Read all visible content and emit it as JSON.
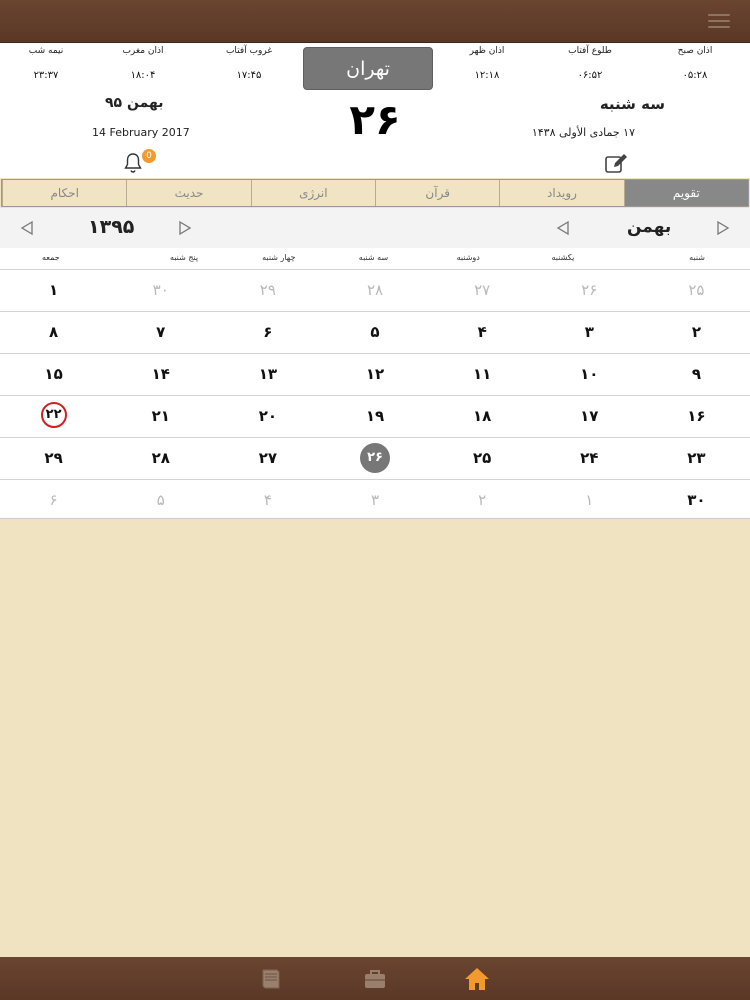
{
  "prayer_times": [
    {
      "label": "اذان صبح",
      "value": "۰۵:۲۸"
    },
    {
      "label": "طلوع آفتاب",
      "value": "۰۶:۵۲"
    },
    {
      "label": "اذان ظهر",
      "value": "۱۲:۱۸"
    },
    {
      "label": "غروب آفتاب",
      "value": "۱۷:۴۵"
    },
    {
      "label": "اذان مغرب",
      "value": "۱۸:۰۴"
    },
    {
      "label": "نیمه شب",
      "value": "۲۳:۳۷"
    }
  ],
  "city": "تهران",
  "today": {
    "day": "۲۶",
    "weekday": "سه شنبه",
    "hijri": "۱۷ جمادی الأولی ۱۴۳۸",
    "persian_month_year": "بهمن ۹۵",
    "gregorian": "14 February 2017"
  },
  "notifications": {
    "count": "0"
  },
  "tabs": [
    "تقویم",
    "رویداد",
    "قرآن",
    "انرژی",
    "حدیث",
    "احکام"
  ],
  "nav": {
    "month": "بهمن",
    "year": "۱۳۹۵"
  },
  "weekdays": [
    "شنبه",
    "یکشنبه",
    "دوشنبه",
    "سه شنبه",
    "چهار شنبه",
    "پنج شنبه",
    "جمعه"
  ],
  "weeks": [
    [
      {
        "d": "۲۵",
        "dim": true
      },
      {
        "d": "۲۶",
        "dim": true
      },
      {
        "d": "۲۷",
        "dim": true
      },
      {
        "d": "۲۸",
        "dim": true
      },
      {
        "d": "۲۹",
        "dim": true
      },
      {
        "d": "۳۰",
        "dim": true
      },
      {
        "d": "۱"
      }
    ],
    [
      {
        "d": "۲"
      },
      {
        "d": "۳"
      },
      {
        "d": "۴"
      },
      {
        "d": "۵"
      },
      {
        "d": "۶"
      },
      {
        "d": "۷"
      },
      {
        "d": "۸"
      }
    ],
    [
      {
        "d": "۹"
      },
      {
        "d": "۱۰"
      },
      {
        "d": "۱۱"
      },
      {
        "d": "۱۲"
      },
      {
        "d": "۱۳"
      },
      {
        "d": "۱۴"
      },
      {
        "d": "۱۵"
      }
    ],
    [
      {
        "d": "۱۶"
      },
      {
        "d": "۱۷"
      },
      {
        "d": "۱۸"
      },
      {
        "d": "۱۹"
      },
      {
        "d": "۲۰"
      },
      {
        "d": "۲۱"
      },
      {
        "d": "۲۲",
        "holiday": true
      }
    ],
    [
      {
        "d": "۲۳"
      },
      {
        "d": "۲۴"
      },
      {
        "d": "۲۵"
      },
      {
        "d": "۲۶",
        "today": true
      },
      {
        "d": "۲۷"
      },
      {
        "d": "۲۸"
      },
      {
        "d": "۲۹"
      }
    ],
    [
      {
        "d": "۳۰"
      },
      {
        "d": "۱",
        "dim": true
      },
      {
        "d": "۲",
        "dim": true
      },
      {
        "d": "۳",
        "dim": true
      },
      {
        "d": "۴",
        "dim": true
      },
      {
        "d": "۵",
        "dim": true
      },
      {
        "d": "۶",
        "dim": true
      }
    ]
  ],
  "icons": {
    "menu": "menu-icon",
    "bell": "bell-icon",
    "edit": "edit-icon",
    "book": "book-icon",
    "briefcase": "briefcase-icon",
    "home": "home-icon"
  },
  "colors": {
    "accent": "#f29a2e",
    "bar": "#5e3b28",
    "paper": "#efe3c2",
    "holiday": "#d02020"
  }
}
